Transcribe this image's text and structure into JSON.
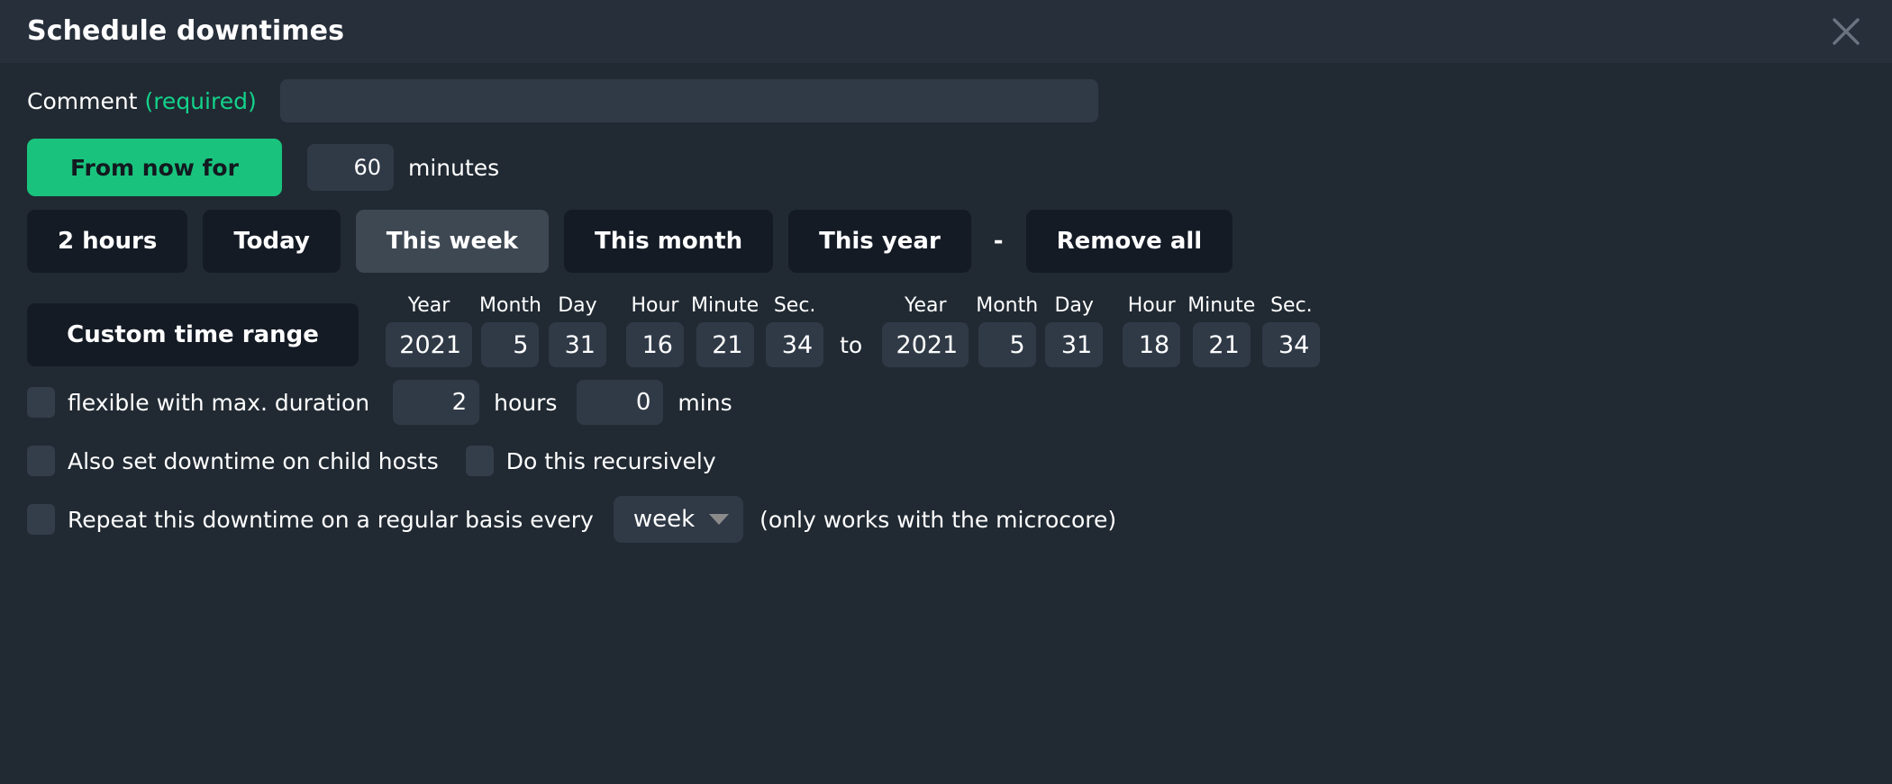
{
  "dialog": {
    "title": "Schedule downtimes",
    "close_icon": "close-icon"
  },
  "comment": {
    "label": "Comment",
    "required_label": "(required)",
    "value": "",
    "placeholder": ""
  },
  "from_now": {
    "button_label": "From now for",
    "minutes_value": "60",
    "minutes_label": "minutes"
  },
  "quick_ranges": {
    "buttons": [
      {
        "label": "2 hours",
        "state": "normal"
      },
      {
        "label": "Today",
        "state": "normal"
      },
      {
        "label": "This week",
        "state": "hover"
      },
      {
        "label": "This month",
        "state": "normal"
      },
      {
        "label": "This year",
        "state": "normal"
      }
    ],
    "separator": "-",
    "remove_all_label": "Remove all"
  },
  "custom_range": {
    "button_label": "Custom time range",
    "to_label": "to",
    "field_labels": {
      "year": "Year",
      "month": "Month",
      "day": "Day",
      "hour": "Hour",
      "minute": "Minute",
      "second": "Sec."
    },
    "start": {
      "year": "2021",
      "month": "5",
      "day": "31",
      "hour": "16",
      "minute": "21",
      "second": "34"
    },
    "end": {
      "year": "2021",
      "month": "5",
      "day": "31",
      "hour": "18",
      "minute": "21",
      "second": "34"
    }
  },
  "flexible": {
    "checked": false,
    "label": "flexible with max. duration",
    "hours_value": "2",
    "hours_label": "hours",
    "mins_value": "0",
    "mins_label": "mins"
  },
  "child_hosts": {
    "checked": false,
    "label": "Also set downtime on child hosts",
    "recursive_checked": false,
    "recursive_label": "Do this recursively"
  },
  "repeat": {
    "checked": false,
    "label": "Repeat this downtime on a regular basis every",
    "interval_value": "week",
    "caret_icon": "chevron-down-icon",
    "note": "(only works with the microcore)"
  },
  "colors": {
    "background": "#212a33",
    "header_background": "#262f3a",
    "accent_green": "#19c37d",
    "required_green": "#13d38a",
    "button_dark": "#141b25",
    "button_hover": "#3e4853",
    "input_background": "#303a47",
    "checkbox_background": "#343d4a"
  }
}
